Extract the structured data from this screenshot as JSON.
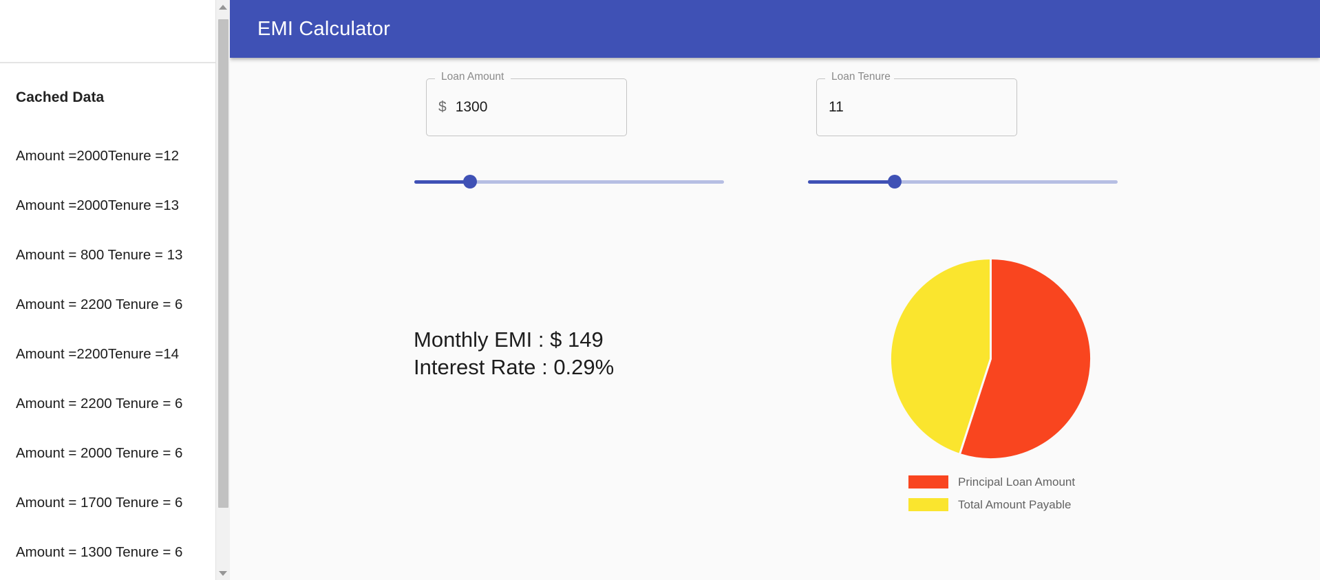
{
  "cache_panel": {
    "title": "Cached Data",
    "items": [
      "Amount =2000Tenure =12",
      "Amount =2000Tenure =13",
      "Amount = 800 Tenure = 13",
      "Amount = 2200 Tenure = 6",
      "Amount =2200Tenure =14",
      "Amount = 2200 Tenure = 6",
      "Amount = 2000 Tenure = 6",
      "Amount = 1700 Tenure = 6",
      "Amount = 1300 Tenure = 6"
    ],
    "scrollbar": {
      "up_arrow": "scroll-up-arrow",
      "down_arrow": "scroll-down-arrow"
    }
  },
  "appbar": {
    "title": "EMI Calculator",
    "color": "#3f51b5"
  },
  "fields": {
    "loan_amount": {
      "label": "Loan Amount",
      "adornment": "$",
      "value": "1300",
      "placeholder": "Loan Amount"
    },
    "loan_tenure": {
      "label": "Loan Tenure",
      "value": "11",
      "placeholder": "Loan Tenure"
    }
  },
  "sliders": {
    "loan_amount": {
      "percent": 18,
      "name": "loan-amount-slider"
    },
    "loan_tenure": {
      "percent": 28,
      "name": "loan-tenure-slider"
    }
  },
  "results": {
    "emi_line": "Monthly EMI : $ 149",
    "interest_line": "Interest Rate : 0.29%"
  },
  "chart_data": {
    "type": "pie",
    "title": "",
    "labels": [
      "Principal Loan Amount",
      "Total Amount Payable"
    ],
    "values": [
      55,
      45
    ],
    "colors": [
      "#f9451f",
      "#fae52e"
    ],
    "start_angle": 0,
    "legend_position": "bottom",
    "slices": [
      {
        "label": "Principal Loan Amount",
        "value": 55,
        "color": "#f9451f"
      },
      {
        "label": "Total Amount Payable",
        "value": 45,
        "color": "#fae52e"
      }
    ]
  }
}
